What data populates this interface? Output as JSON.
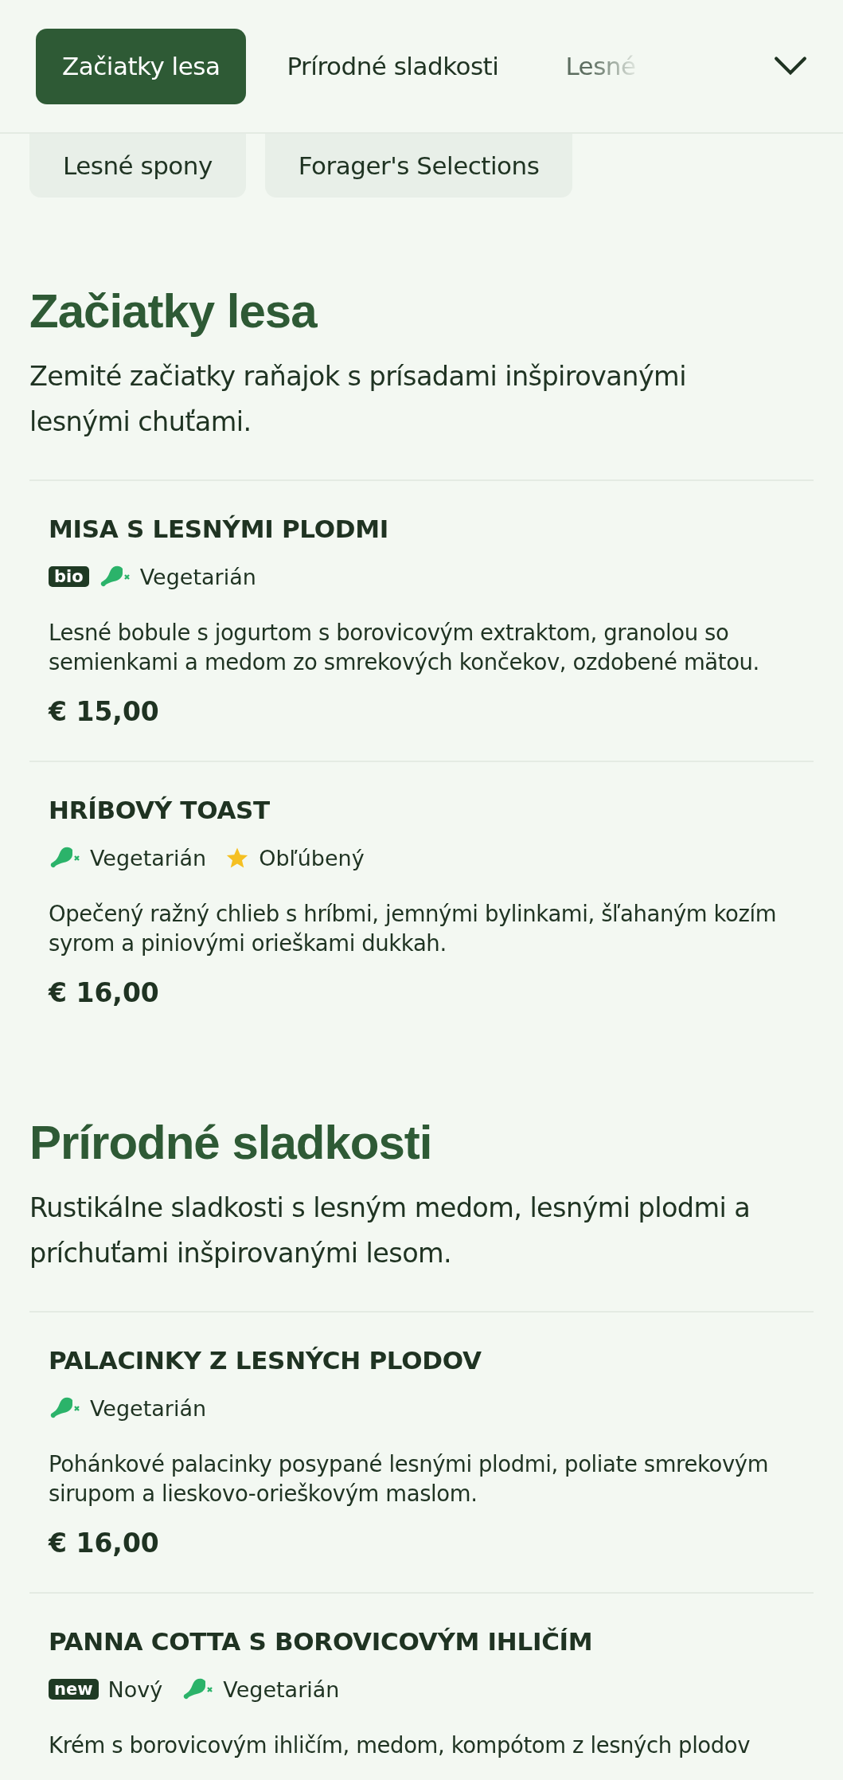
{
  "tabs": [
    {
      "label": "Začiatky lesa",
      "selected": true
    },
    {
      "label": "Prírodné sladkosti",
      "selected": false
    },
    {
      "label": "Lesné",
      "selected": false
    }
  ],
  "chips": [
    {
      "label": "Lesné spony"
    },
    {
      "label": "Forager's Selections"
    }
  ],
  "sections": [
    {
      "title": "Začiatky lesa",
      "description": "Zemité začiatky raňajok s prísadami inšpirovanými lesnými chuťami.",
      "items": [
        {
          "name": "MISA S LESNÝMI PLODMI",
          "tags": [
            {
              "kind": "badge",
              "text": "bio"
            },
            {
              "kind": "vegetarian",
              "label": "Vegetarián"
            }
          ],
          "description": "Lesné bobule s jogurtom s borovicovým extraktom, granolou so semienkami a medom zo smrekových končekov, ozdobené mätou.",
          "price": "€ 15,00"
        },
        {
          "name": "HRÍBOVÝ TOAST",
          "tags": [
            {
              "kind": "vegetarian",
              "label": "Vegetarián"
            },
            {
              "kind": "favorite",
              "label": "Obľúbený"
            }
          ],
          "description": "Opečený ražný chlieb s hríbmi, jemnými bylinkami, šľahaným kozím syrom a piniovými orieškami dukkah.",
          "price": "€ 16,00"
        }
      ]
    },
    {
      "title": "Prírodné sladkosti",
      "description": "Rustikálne sladkosti s lesným medom, lesnými plodmi a príchuťami inšpirovanými lesom.",
      "items": [
        {
          "name": "PALACINKY Z LESNÝCH PLODOV",
          "tags": [
            {
              "kind": "vegetarian",
              "label": "Vegetarián"
            }
          ],
          "description": "Pohánkové palacinky posypané lesnými plodmi, poliate smrekovým sirupom a lieskovo-orieškovým maslom.",
          "price": "€ 16,00"
        },
        {
          "name": "PANNA COTTA S BOROVICOVÝM IHLIČÍM",
          "tags": [
            {
              "kind": "badge",
              "text": "new",
              "label": "Nový"
            },
            {
              "kind": "vegetarian",
              "label": "Vegetarián"
            }
          ],
          "description": "Krém s borovicovým ihličím, medom, kompótom z lesných plodov"
        }
      ]
    }
  ]
}
